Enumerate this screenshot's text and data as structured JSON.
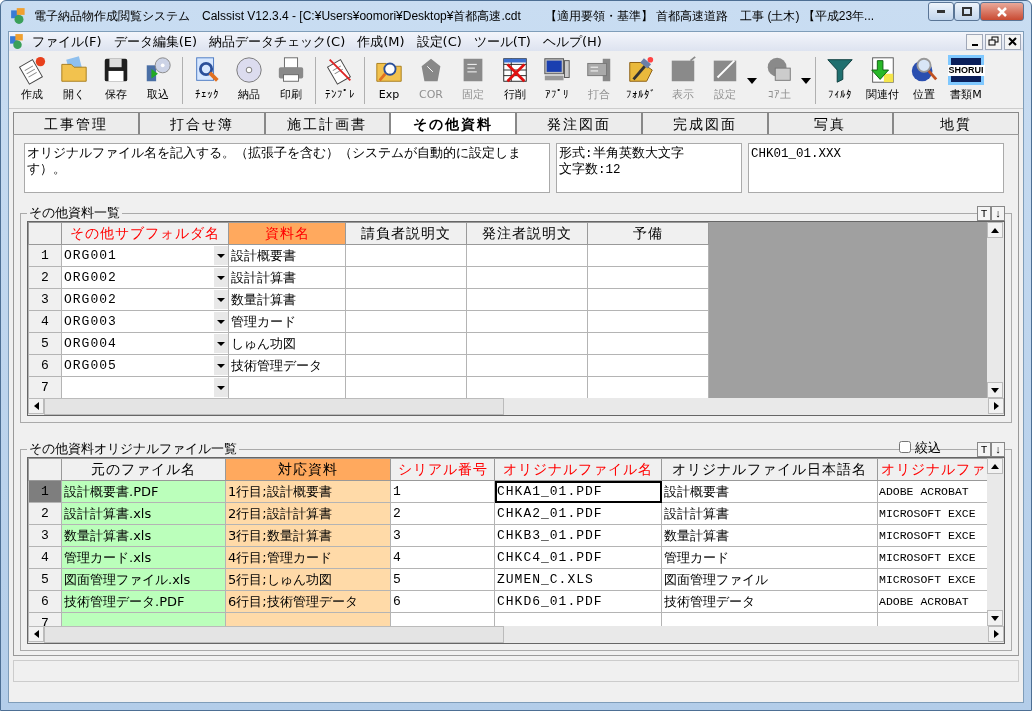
{
  "window": {
    "title": "電子納品物作成閲覧システム　Calssist V12.3.4 - [C:¥Users¥oomori¥Desktop¥首都高速.cdt　　【適用要領・基準】 首都高速道路　工事 (土木) 【平成23年..."
  },
  "menu": [
    "ファイル(F)",
    "データ編集(E)",
    "納品データチェック(C)",
    "作成(M)",
    "設定(C)",
    "ツール(T)",
    "ヘルプ(H)"
  ],
  "toolbar": [
    {
      "kind": "button",
      "label": "作成",
      "disabled": false
    },
    {
      "kind": "button",
      "label": "開く",
      "disabled": false
    },
    {
      "kind": "button",
      "label": "保存",
      "disabled": false
    },
    {
      "kind": "button",
      "label": "取込",
      "disabled": false
    },
    {
      "kind": "separator"
    },
    {
      "kind": "button",
      "label": "ﾁｪｯｸ",
      "disabled": false
    },
    {
      "kind": "button",
      "label": "納品",
      "disabled": false
    },
    {
      "kind": "button",
      "label": "印刷",
      "disabled": false
    },
    {
      "kind": "separator"
    },
    {
      "kind": "button",
      "label": "ﾃﾝﾌﾟﾚ",
      "disabled": false
    },
    {
      "kind": "separator"
    },
    {
      "kind": "button",
      "label": "Exp",
      "disabled": false
    },
    {
      "kind": "button",
      "label": "COR",
      "disabled": true
    },
    {
      "kind": "button",
      "label": "固定",
      "disabled": true
    },
    {
      "kind": "button",
      "label": "行削",
      "disabled": false
    },
    {
      "kind": "button",
      "label": "ｱﾌﾟﾘ",
      "disabled": false
    },
    {
      "kind": "button",
      "label": "打合",
      "disabled": true
    },
    {
      "kind": "button",
      "label": "ﾌｫﾙﾀﾞ",
      "disabled": false
    },
    {
      "kind": "button",
      "label": "表示",
      "disabled": true
    },
    {
      "kind": "button",
      "label": "設定",
      "disabled": true,
      "menu": true
    },
    {
      "kind": "button",
      "label": "ｺｱ土",
      "disabled": true,
      "menu": true
    },
    {
      "kind": "separator"
    },
    {
      "kind": "button",
      "label": "ﾌｨﾙﾀ",
      "disabled": false
    },
    {
      "kind": "button",
      "label": "関連付",
      "disabled": false
    },
    {
      "kind": "button",
      "label": "位置",
      "disabled": false
    },
    {
      "kind": "button",
      "label": "書類M",
      "disabled": false,
      "icon_text": "SHORUI"
    }
  ],
  "tabs": [
    {
      "label": "工事管理",
      "selected": false
    },
    {
      "label": "打合せ簿",
      "selected": false
    },
    {
      "label": "施工計画書",
      "selected": false
    },
    {
      "label": "その他資料",
      "selected": true
    },
    {
      "label": "発注図面",
      "selected": false
    },
    {
      "label": "完成図面",
      "selected": false
    },
    {
      "label": "写真",
      "selected": false
    },
    {
      "label": "地質",
      "selected": false
    }
  ],
  "info": {
    "description": "オリジナルファイル名を記入する。（拡張子を含む）（システムが自動的に設定します）。",
    "format": [
      "形式:半角英数大文字",
      "文字数:12"
    ],
    "example": "CHK01_01.XXX"
  },
  "material_list": {
    "title": "その他資料一覧",
    "sort_buttons": [
      "T",
      "↓"
    ],
    "columns": [
      {
        "label": "その他サブフォルダ名",
        "required": true,
        "selected": false,
        "kind": "combo"
      },
      {
        "label": "資料名",
        "required": true,
        "selected": true,
        "kind": "text"
      },
      {
        "label": "請負者説明文",
        "required": false,
        "selected": false,
        "kind": "text"
      },
      {
        "label": "発注者説明文",
        "required": false,
        "selected": false,
        "kind": "text"
      },
      {
        "label": "予備",
        "required": false,
        "selected": false,
        "kind": "text"
      }
    ],
    "rows": [
      {
        "number": "1",
        "cells": [
          "ORG001",
          "設計概要書"
        ]
      },
      {
        "number": "2",
        "cells": [
          "ORG002",
          "設計計算書"
        ]
      },
      {
        "number": "3",
        "cells": [
          "ORG002",
          "数量計算書"
        ]
      },
      {
        "number": "4",
        "cells": [
          "ORG003",
          "管理カード"
        ]
      },
      {
        "number": "5",
        "cells": [
          "ORG004",
          "しゅん功図"
        ]
      },
      {
        "number": "6",
        "cells": [
          "ORG005",
          "技術管理データ"
        ]
      },
      {
        "number": "7"
      }
    ]
  },
  "original_files": {
    "title": "その他資料オリジナルファイル一覧",
    "filter": {
      "label": "絞込",
      "checked": false
    },
    "sort_buttons": [
      "T",
      "↓"
    ],
    "columns": [
      {
        "label": "元のファイル名",
        "required": false,
        "selected": false,
        "current": false,
        "color": "#bbffbb"
      },
      {
        "label": "対応資料",
        "required": false,
        "selected": true,
        "current": false,
        "color": "#ffdaa8"
      },
      {
        "label": "シリアル番号",
        "required": true,
        "selected": false,
        "current": false
      },
      {
        "label": "オリジナルファイル名",
        "required": true,
        "selected": false,
        "current": true
      },
      {
        "label": "オリジナルファイル日本語名",
        "required": false,
        "selected": false,
        "current": false
      },
      {
        "label": "オリジナルファ",
        "required": true,
        "selected": false,
        "current": false
      }
    ],
    "rows": [
      {
        "number": "1",
        "selected": true,
        "cells": [
          "設計概要書.PDF",
          "1行目;設計概要書",
          "1",
          "CHKA1_01.PDF",
          "設計概要書",
          "ADOBE ACROBAT"
        ]
      },
      {
        "number": "2",
        "selected": false,
        "cells": [
          "設計計算書.xls",
          "2行目;設計計算書",
          "2",
          "CHKA2_01.PDF",
          "設計計算書",
          "MICROSOFT EXCE"
        ]
      },
      {
        "number": "3",
        "selected": false,
        "cells": [
          "数量計算書.xls",
          "3行目;数量計算書",
          "3",
          "CHKB3_01.PDF",
          "数量計算書",
          "MICROSOFT EXCE"
        ]
      },
      {
        "number": "4",
        "selected": false,
        "cells": [
          "管理カード.xls",
          "4行目;管理カード",
          "4",
          "CHKC4_01.PDF",
          "管理カード",
          "MICROSOFT EXCE"
        ]
      },
      {
        "number": "5",
        "selected": false,
        "cells": [
          "図面管理ファイル.xls",
          "5行目;しゅん功図",
          "5",
          "ZUMEN_C.XLS",
          "図面管理ファイル",
          "MICROSOFT EXCE"
        ]
      },
      {
        "number": "6",
        "selected": false,
        "cells": [
          "技術管理データ.PDF",
          "6行目;技術管理データ",
          "6",
          "CHKD6_01.PDF",
          "技術管理データ",
          "ADOBE ACROBAT"
        ]
      },
      {
        "number": "7",
        "selected": false
      }
    ]
  }
}
